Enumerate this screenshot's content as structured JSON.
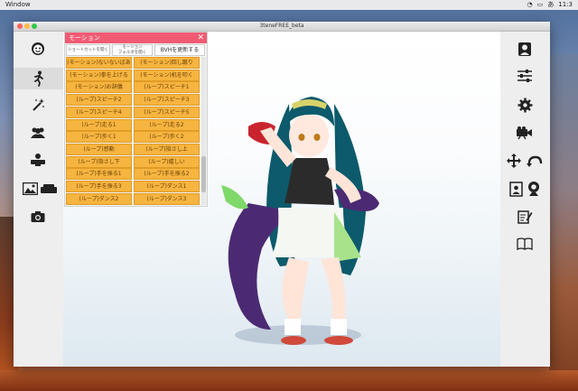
{
  "menubar": {
    "app_name": "Window",
    "clock": "11:3"
  },
  "window": {
    "title": "3teneFREE_beta"
  },
  "panel": {
    "title": "モーション",
    "close_glyph": "✕",
    "buttons": {
      "shortcut": "ショートカットを開く",
      "motion_folder": "モーション\nフォルダを開く",
      "bvh_update": "BVHを更新する"
    },
    "motions": [
      "(モーション)ないないばあ",
      "(モーション)回し蹴り",
      "(モーション)拳を上げる",
      "(モーション)机を叩く",
      "(モーション)お辞儀",
      "(ループ)スピーチ1",
      "(ループ)スピーチ2",
      "(ループ)スピーチ3",
      "(ループ)スピーチ4",
      "(ループ)スピーチ5",
      "(ループ)走る1",
      "(ループ)走る2",
      "(ループ)歩く1",
      "(ループ)歩く2",
      "(ループ)感動",
      "(ループ)指さし上",
      "(ループ)指さし下",
      "(ループ)嬉しい",
      "(ループ)手を振る1",
      "(ループ)手を振る2",
      "(ループ)手を振る3",
      "(ループ)ダンス1",
      "(ループ)ダンス2",
      "(ループ)ダンス3"
    ]
  },
  "left_toolbar": [
    "face-icon",
    "motion-pose-icon",
    "effect-wand-icon",
    "users-icon",
    "camera-stand-icon",
    "background-image-icon",
    "sofa-icon",
    "camera-icon"
  ],
  "right_toolbar": [
    "avatar-icon",
    "sliders-icon",
    "settings-gear-icon",
    "video-camera-icon",
    "move-icon",
    "rotate-icon",
    "id-card-icon",
    "webcam-icon",
    "edit-icon",
    "book-icon"
  ],
  "colors": {
    "panel_header": "#f05b73",
    "motion_button": "#f6b440",
    "hair": "#0c5a6b"
  }
}
